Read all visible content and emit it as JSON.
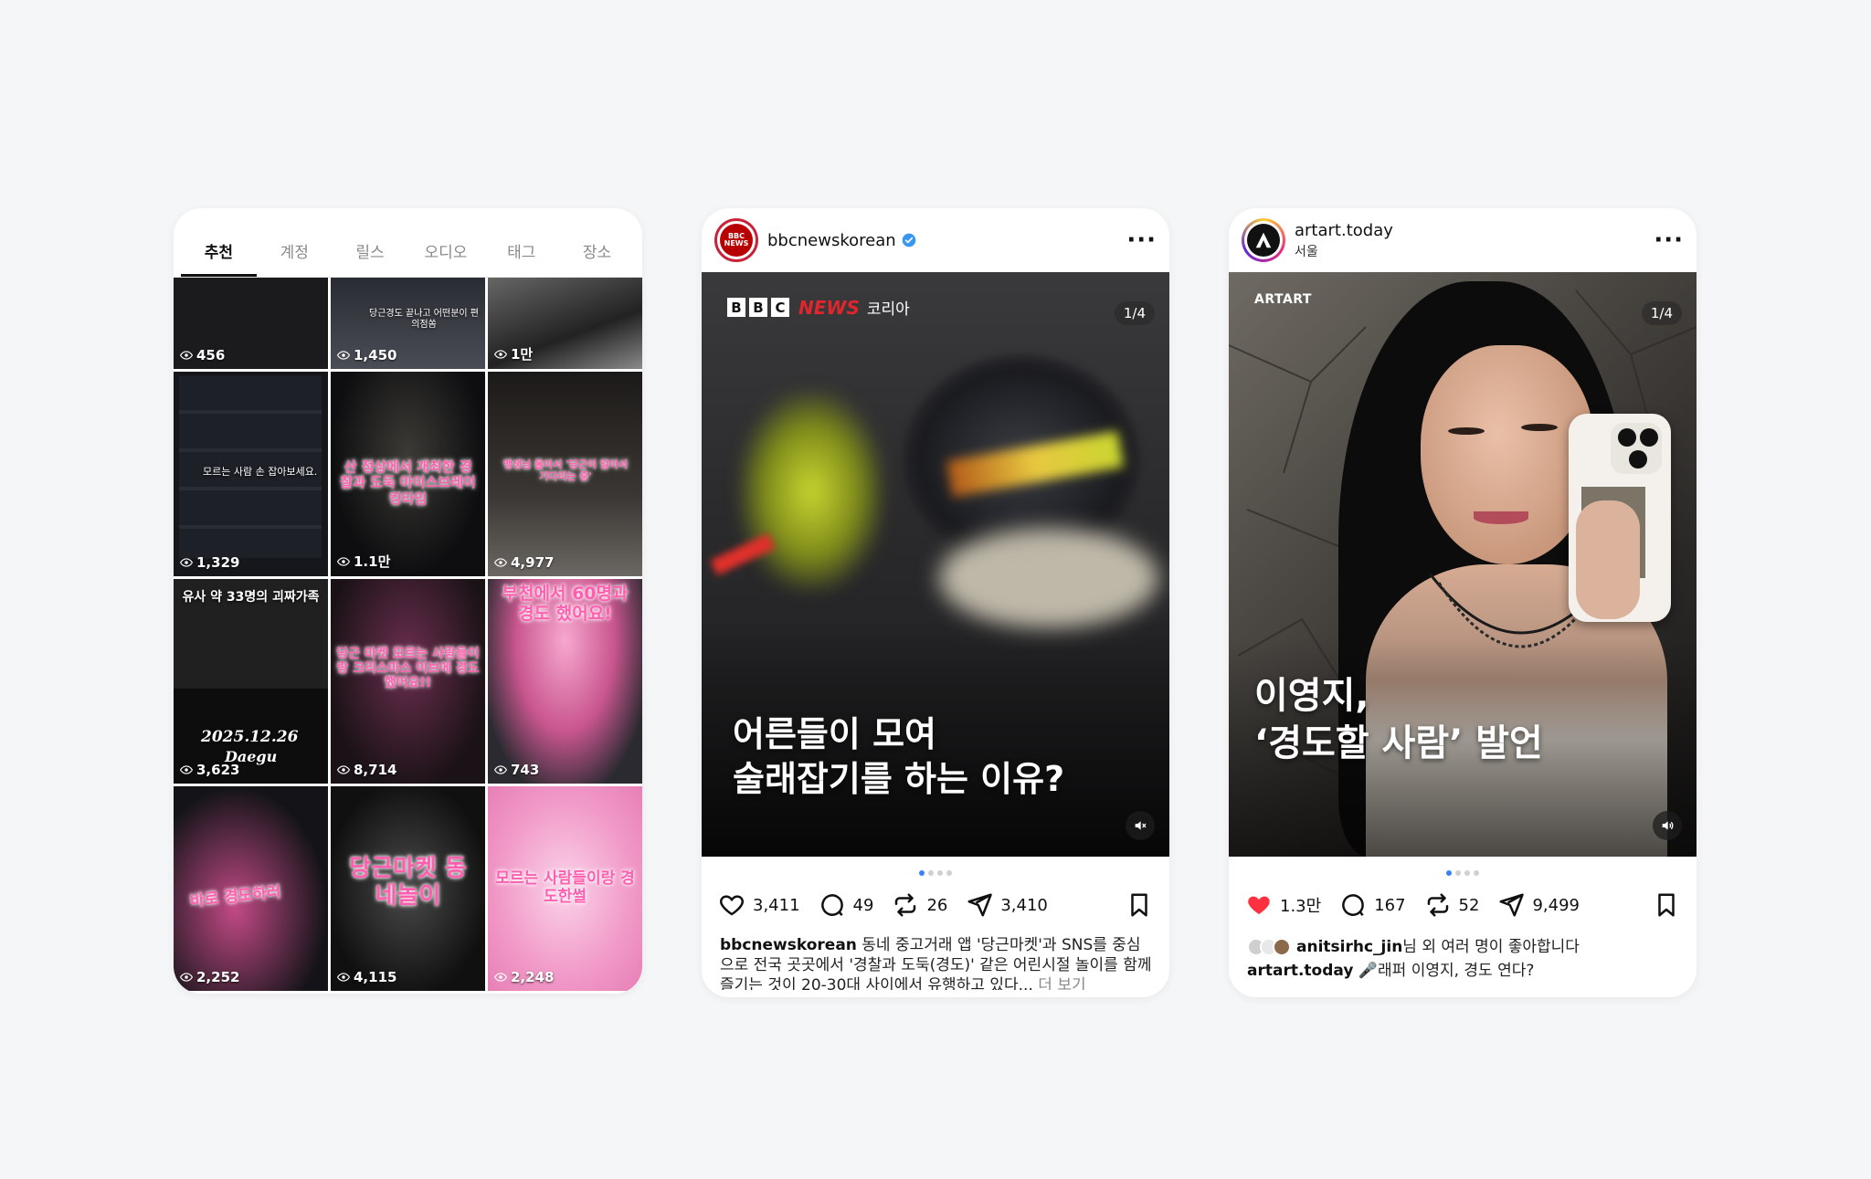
{
  "explore": {
    "tabs": [
      "추천",
      "계정",
      "릴스",
      "오디오",
      "태그",
      "장소"
    ],
    "tiles": [
      {
        "views": "456",
        "caption": ""
      },
      {
        "views": "1,450",
        "caption": "당근경도 끝나고 어떤분이 편의점쏨"
      },
      {
        "views": "1만",
        "caption": ""
      },
      {
        "views": "1,329",
        "caption": "모르는 사람 손 잡아보세요."
      },
      {
        "views": "1.1만",
        "caption": "산 정상에서 개최한 경찰과 도둑 아이스브레이킹타임"
      },
      {
        "views": "4,977",
        "caption": "맹생님 돌아서 '당근이 알아서 기다리는 중'"
      },
      {
        "views": "3,623",
        "caption": "유사 약 33명의 괴짜가족",
        "date": "2025.12.26",
        "place": "Daegu"
      },
      {
        "views": "8,714",
        "caption": "당근 마켓 모르는 사람들이랑 크리스마스 이브에 경도했어요!!"
      },
      {
        "views": "743",
        "caption": "부천에서 60명과 경도 했어요!"
      },
      {
        "views": "2,252",
        "caption": "바로 경도하러"
      },
      {
        "views": "4,115",
        "caption": "당근마켓 동네놀이"
      },
      {
        "views": "2,248",
        "caption": "모르는 사람들이랑 경도한썰"
      }
    ]
  },
  "bbc_post": {
    "account": "bbcnewskorean",
    "avatar_text": "BBC NEWS",
    "brand_letters": [
      "B",
      "B",
      "C"
    ],
    "brand_news": "NEWS",
    "brand_region": "코리아",
    "counter": "1/4",
    "headline_1": "어른들이 모여",
    "headline_2": "술래잡기를 하는 이유?",
    "likes": "3,411",
    "comments": "49",
    "reposts": "26",
    "shares": "3,410",
    "caption_text": "동네 중고거래 앱 '당근마켓'과 SNS를 중심으로 전국 곳곳에서 '경찰과 도둑(경도)' 같은 어린시절 놀이를 함께 즐기는 것이 20-30대 사이에서 유행하고 있다...",
    "more_label": "더 보기"
  },
  "artart_post": {
    "account": "artart.today",
    "location": "서울",
    "brand": "ARTART",
    "counter": "1/4",
    "headline_1": "이영지,",
    "headline_2": "‘경도할 사람’ 발언",
    "likes": "1.3만",
    "comments": "167",
    "reposts": "52",
    "shares": "9,499",
    "liked_by_user": "anitsirhc_jin",
    "liked_by_suffix": "님 외 여러 명이 좋아합니다",
    "caption_text": "🎤래퍼 이영지, 경도 연다?"
  },
  "colors": {
    "like_red": "#ff3040",
    "verified_blue": "#3897f0",
    "dot_active": "#3b82f6"
  }
}
